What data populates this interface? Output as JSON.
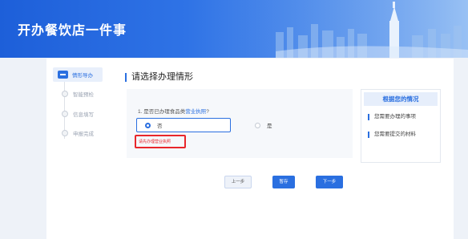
{
  "header": {
    "title": "开办餐饮店一件事"
  },
  "sidebar": {
    "steps": [
      {
        "label": "情形导办",
        "active": true
      },
      {
        "label": "智能预检",
        "active": false
      },
      {
        "label": "信息填写",
        "active": false
      },
      {
        "label": "申报完成",
        "active": false
      }
    ]
  },
  "main": {
    "title": "请选择办理情形",
    "question": {
      "text": "1. 是否已办理食品类",
      "link": "营业执照",
      "suffix": "?",
      "options": [
        {
          "label": "否",
          "selected": true
        },
        {
          "label": "是",
          "selected": false
        }
      ],
      "warning": "请先办理营业执照"
    }
  },
  "info_panel": {
    "title": "根据您的情况",
    "items": [
      "您需要办理的事项",
      "您需要提交的材料"
    ]
  },
  "buttons": {
    "prev": "上一步",
    "save": "暂存",
    "next": "下一步"
  },
  "colors": {
    "accent": "#2a6fe0",
    "warning": "#e8262b",
    "banner": "#2f73e6"
  }
}
